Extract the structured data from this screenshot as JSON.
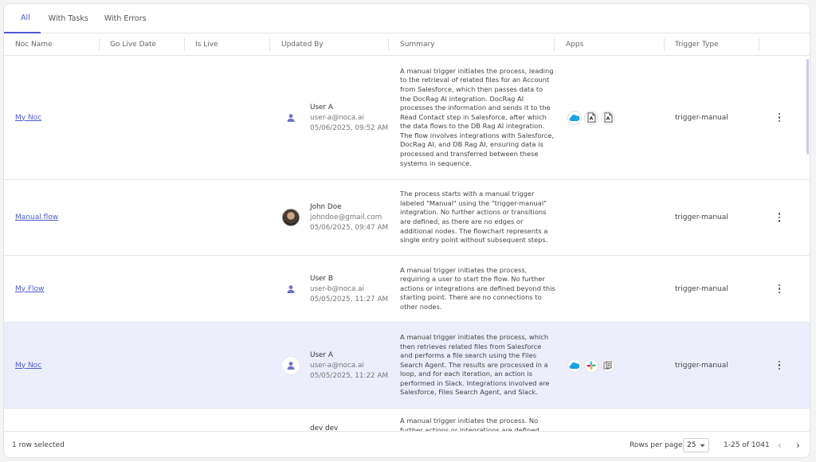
{
  "tabs": [
    "All",
    "With Tasks",
    "With Errors"
  ],
  "columns": {
    "noc_name": "Noc Name",
    "go_live_date": "Go Live Date",
    "is_live": "Is Live",
    "updated_by": "Updated By",
    "summary": "Summary",
    "apps": "Apps",
    "trigger_type": "Trigger Type"
  },
  "rows": [
    {
      "noc_name": "My Noc",
      "user_name": "User A",
      "user_email": "user-a@noca.ai",
      "updated_at": "05/06/2025, 09:52 AM",
      "avatar": "default-user-icon",
      "summary": "A manual trigger initiates the process, leading to the retrieval of related files for an Account from Salesforce, which then passes data to the DocRag AI integration. DocRag AI processes the information and sends it to the Read Contact step in Salesforce, after which the data flows to the DB Rag AI integration. The flow involves integrations with Salesforce, DocRag AI, and DB Rag AI, ensuring data is processed and transferred between these systems in sequence.",
      "apps": [
        "salesforce-icon",
        "docrag-ai-icon",
        "dbrag-ai-icon"
      ],
      "trigger_type": "trigger-manual"
    },
    {
      "noc_name": "Manual flow",
      "user_name": "John Doe",
      "user_email": "johndoe@gmail.com",
      "updated_at": "05/06/2025, 09:47 AM",
      "avatar": "photo",
      "summary": "The process starts with a manual trigger labeled \"Manual\" using the \"trigger-manual\" integration. No further actions or transitions are defined, as there are no edges or additional nodes. The flowchart represents a single entry point without subsequent steps.",
      "apps": [],
      "trigger_type": "trigger-manual"
    },
    {
      "noc_name": "My Flow",
      "user_name": "User B",
      "user_email": "user-b@noca.ai",
      "updated_at": "05/05/2025, 11:27 AM",
      "avatar": "default-user-icon",
      "summary": "A manual trigger initiates the process, requiring a user to start the flow. No further actions or integrations are defined beyond this starting point. There are no connections to other nodes.",
      "apps": [],
      "trigger_type": "trigger-manual"
    },
    {
      "noc_name": "My Noc",
      "user_name": "User A",
      "user_email": "user-a@noca.ai",
      "updated_at": "05/05/2025, 11:22 AM",
      "avatar": "default-user-icon",
      "summary": "A manual trigger initiates the process, which then retrieves related files from Salesforce and performs a file search using the Files Search Agent. The results are processed in a loop, and for each iteration, an action is performed in Slack. Integrations involved are Salesforce, Files Search Agent, and Slack.",
      "apps": [
        "salesforce-icon",
        "slack-icon",
        "files-search-agent-icon"
      ],
      "trigger_type": "trigger-manual"
    },
    {
      "noc_name": "",
      "user_name": "dev dev",
      "user_email": "",
      "updated_at": "",
      "avatar": "default-user-icon",
      "summary": "A manual trigger initiates the process. No further actions or integrations are defined",
      "apps": [],
      "trigger_type": ""
    }
  ],
  "footer": {
    "selection": "1 row selected",
    "rows_per_page_label": "Rows per page:",
    "rows_per_page_value": "25",
    "range": "1-25 of 1041"
  },
  "colors": {
    "accent": "#4f5bd5",
    "selected_row": "#eceefb",
    "salesforce": "#1ea1e2"
  }
}
